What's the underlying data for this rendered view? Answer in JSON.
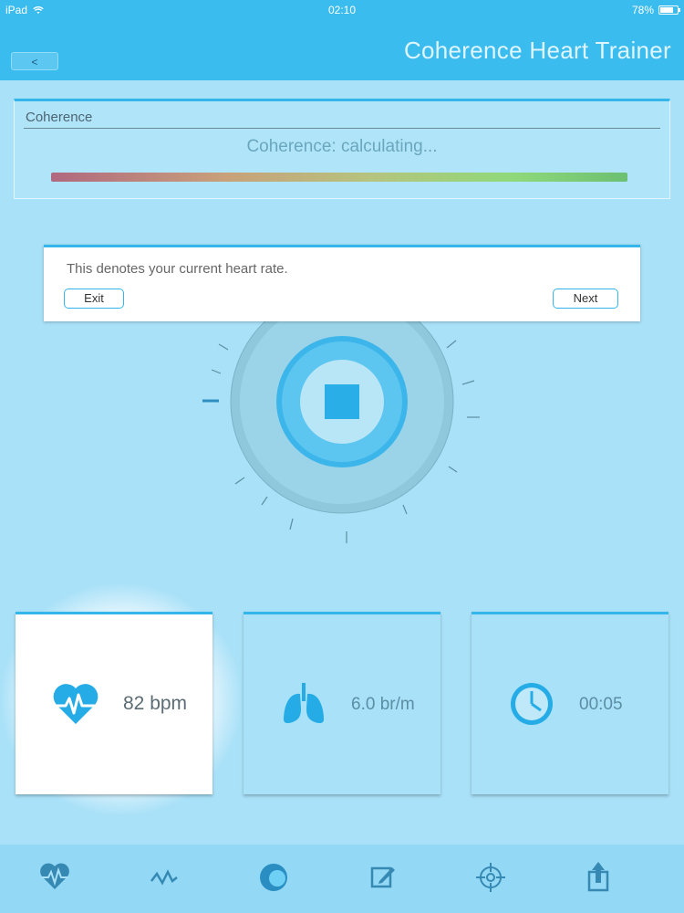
{
  "status_bar": {
    "device": "iPad",
    "time": "02:10",
    "battery": "78%"
  },
  "nav": {
    "back_label": "<",
    "title": "Coherence Heart Trainer"
  },
  "coherence": {
    "label": "Coherence",
    "status": "Coherence: calculating..."
  },
  "tip": {
    "text": "This denotes your current heart rate.",
    "exit_label": "Exit",
    "next_label": "Next"
  },
  "metrics": {
    "heart_rate": "82 bpm",
    "breath_rate": "6.0 br/m",
    "timer": "00:05"
  },
  "colors": {
    "accent": "#35b6ea",
    "background": "#a9e1f8",
    "header": "#3bbcee"
  },
  "icons": {
    "tabs": [
      "heart-rate-icon",
      "waveform-icon",
      "session-icon",
      "notes-icon",
      "target-icon",
      "share-icon"
    ]
  }
}
